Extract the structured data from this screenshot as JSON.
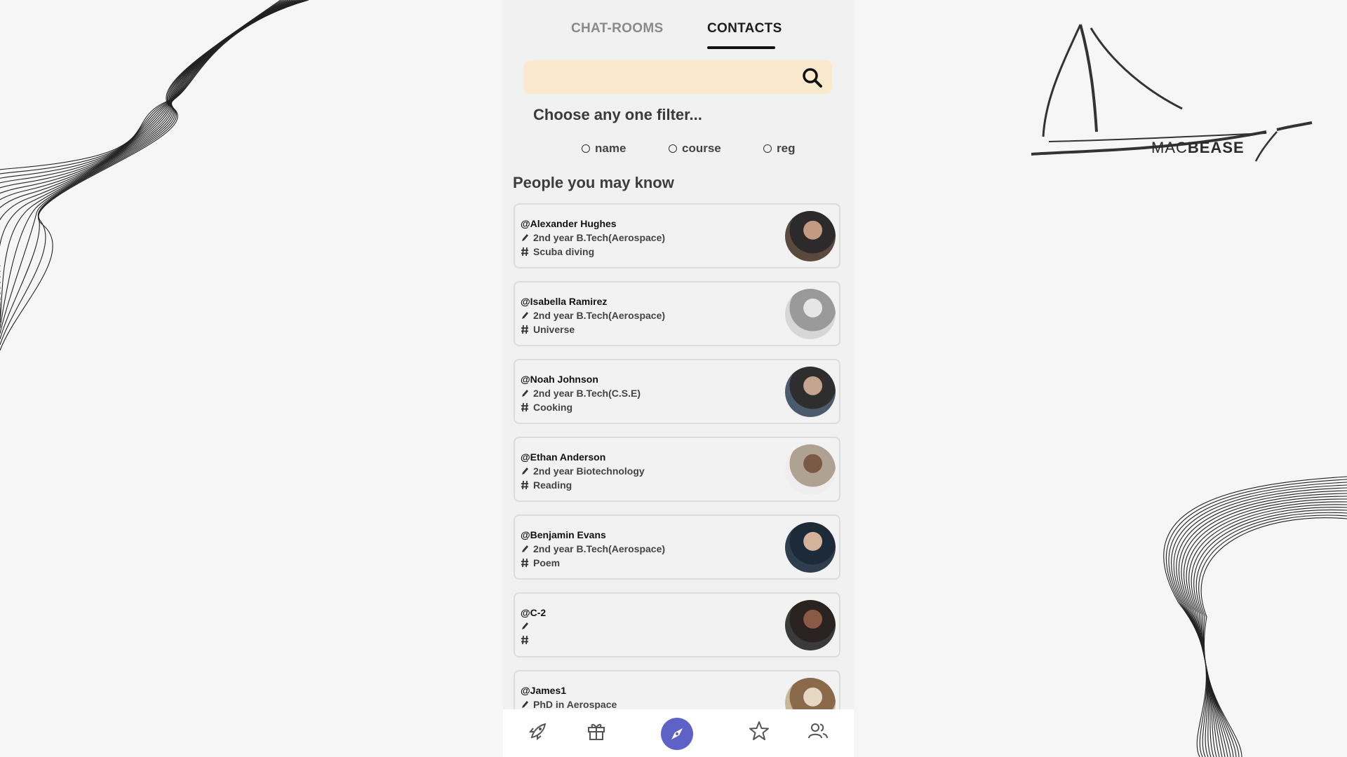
{
  "brand": {
    "logo_light": "MAC",
    "logo_bold": "BEASE"
  },
  "tabs": [
    {
      "label": "CHAT-ROOMS",
      "active": false
    },
    {
      "label": "CONTACTS",
      "active": true
    }
  ],
  "search": {
    "placeholder": "",
    "value": ""
  },
  "filter": {
    "title": "Choose any one filter...",
    "options": [
      "name",
      "course",
      "reg"
    ]
  },
  "section_title": "People you may know",
  "contacts": [
    {
      "name": "@Alexander Hughes",
      "course": "2nd year B.Tech(Aerospace)",
      "interest": "Scuba diving"
    },
    {
      "name": "@Isabella Ramirez",
      "course": "2nd year B.Tech(Aerospace)",
      "interest": "Universe"
    },
    {
      "name": "@Noah Johnson",
      "course": "2nd year B.Tech(C.S.E)",
      "interest": "Cooking"
    },
    {
      "name": "@Ethan Anderson",
      "course": "2nd year Biotechnology",
      "interest": "Reading"
    },
    {
      "name": "@Benjamin Evans",
      "course": "2nd year B.Tech(Aerospace)",
      "interest": "Poem"
    },
    {
      "name": "@C-2",
      "course": "",
      "interest": ""
    },
    {
      "name": "@James1",
      "course": "PhD in Aerospace",
      "interest": ""
    }
  ],
  "bottom_nav": [
    "rocket-icon",
    "gift-icon",
    "compass-icon",
    "star-icon",
    "people-icon"
  ],
  "colors": {
    "accent": "#5e61c6",
    "search_bg": "#fbe9cd"
  }
}
